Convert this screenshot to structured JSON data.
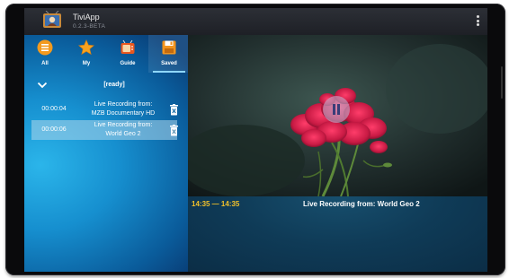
{
  "app": {
    "title": "TiviApp",
    "version": "0.2.3-BETA"
  },
  "tabs": [
    {
      "label": "All",
      "icon": "list-icon"
    },
    {
      "label": "My",
      "icon": "star-icon"
    },
    {
      "label": "Guide",
      "icon": "tv-guide-icon"
    },
    {
      "label": "Saved",
      "icon": "save-icon",
      "selected": true
    }
  ],
  "recordings": {
    "status": "[ready]",
    "items": [
      {
        "duration": "00:00:04",
        "title_line1": "Live Recording from:",
        "title_line2": "MZB Documentary HD",
        "selected": false
      },
      {
        "duration": "00:00:06",
        "title_line1": "Live Recording from:",
        "title_line2": "World Geo 2",
        "selected": true
      }
    ]
  },
  "player": {
    "state": "paused",
    "time_range": "14:35 — 14:35",
    "program_title": "Live Recording from: World Geo 2"
  },
  "colors": {
    "accent_blue": "#168fcf",
    "time_yellow": "#f2c12a",
    "selected_row": "#afd7eb"
  }
}
